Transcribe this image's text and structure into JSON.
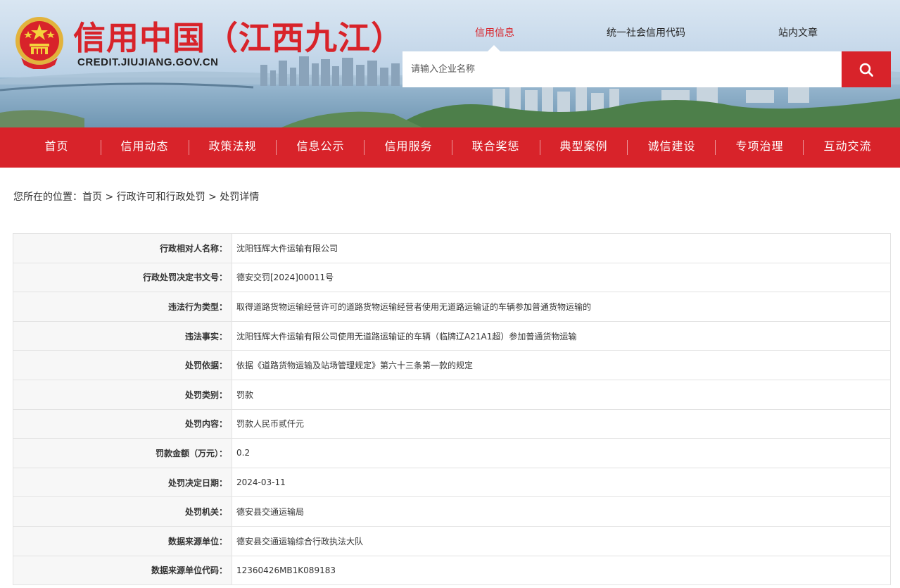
{
  "header": {
    "site_title": "信用中国（江西九江）",
    "site_domain": "CREDIT.JIUJIANG.GOV.CN",
    "top_tabs": [
      "信用信息",
      "统一社会信用代码",
      "站内文章"
    ],
    "active_tab": "信用信息",
    "search": {
      "placeholder": "请输入企业名称",
      "value": ""
    },
    "icons": {
      "emblem": "national-emblem-icon",
      "search": "search-icon"
    }
  },
  "nav": {
    "items": [
      "首页",
      "信用动态",
      "政策法规",
      "信息公示",
      "信用服务",
      "联合奖惩",
      "典型案例",
      "诚信建设",
      "专项治理",
      "互动交流"
    ]
  },
  "breadcrumb": {
    "prefix": "您所在的位置：",
    "items": [
      "首页",
      "行政许可和行政处罚",
      "处罚详情"
    ],
    "separator": " > "
  },
  "detail": {
    "rows": [
      {
        "label": "行政相对人名称：",
        "value": "沈阳钰辉大件运输有限公司"
      },
      {
        "label": "行政处罚决定书文号：",
        "value": "德安交罚[2024]00011号"
      },
      {
        "label": "违法行为类型：",
        "value": "取得道路货物运输经营许可的道路货物运输经营者使用无道路运输证的车辆参加普通货物运输的"
      },
      {
        "label": "违法事实：",
        "value": "沈阳钰辉大件运输有限公司使用无道路运输证的车辆（临牌辽A21A1超）参加普通货物运输"
      },
      {
        "label": "处罚依据：",
        "value": "依据《道路货物运输及站场管理规定》第六十三条第一款的规定"
      },
      {
        "label": "处罚类别：",
        "value": "罚款"
      },
      {
        "label": "处罚内容：",
        "value": "罚款人民币贰仟元"
      },
      {
        "label": "罚款金额（万元）：",
        "value": "0.2"
      },
      {
        "label": "处罚决定日期：",
        "value": "2024-03-11"
      },
      {
        "label": "处罚机关：",
        "value": "德安县交通运输局"
      },
      {
        "label": "数据来源单位：",
        "value": "德安县交通运输综合行政执法大队"
      },
      {
        "label": "数据来源单位代码：",
        "value": "12360426MB1K089183"
      }
    ]
  },
  "colors": {
    "brand_red": "#d8232a",
    "label_bg": "#f7f7f7",
    "border": "#e3e3e3"
  }
}
